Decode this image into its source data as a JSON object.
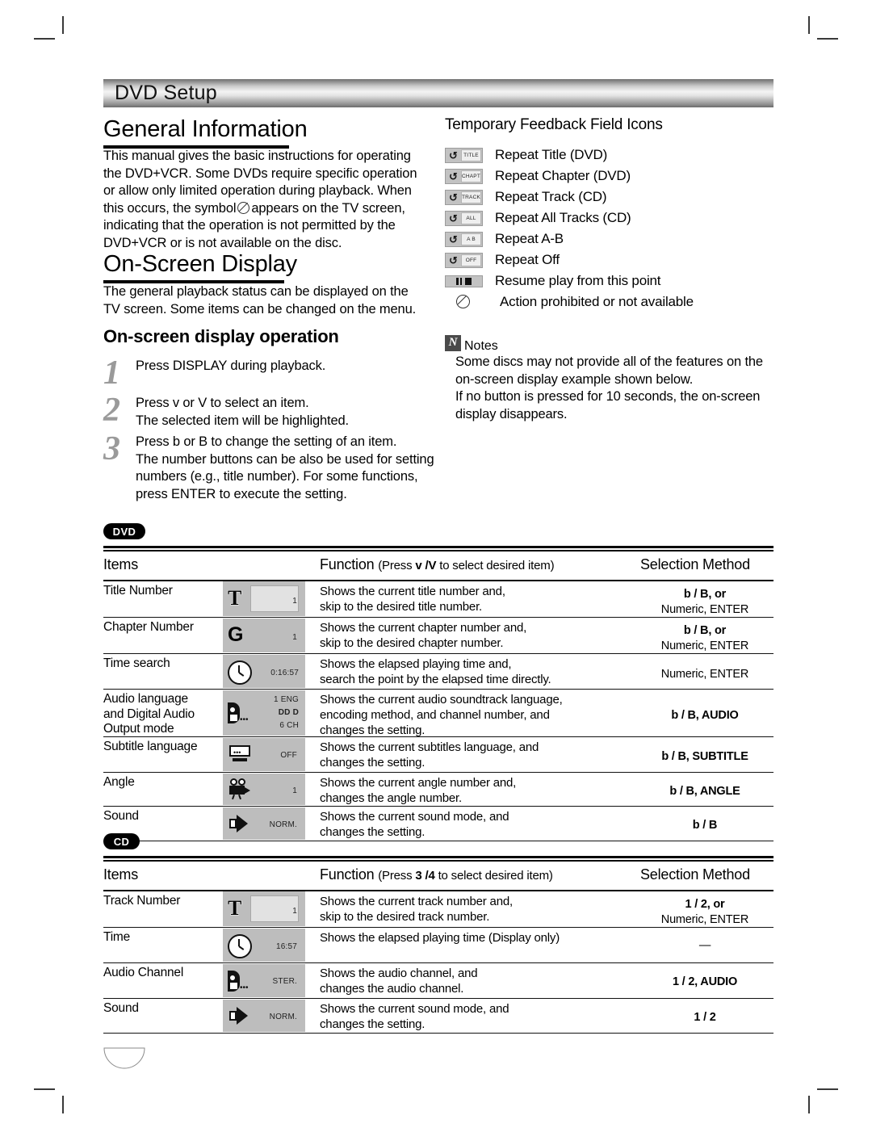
{
  "chapter": {
    "title": "DVD Setup"
  },
  "sections": {
    "general": {
      "heading": "General Information",
      "body_lines": [
        "This manual gives the basic instructions for operating",
        "the DVD+VCR. Some DVDs require specific operation",
        "or allow only limited operation during playback. When",
        "this occurs, the symbol",
        "appears on the TV screen,",
        "indicating that the operation is not permitted by the",
        "DVD+VCR or is not available on the disc."
      ]
    },
    "osd": {
      "heading": "On-Screen Display",
      "body_lines": [
        "The general playback status can be displayed on the",
        "TV screen. Some items can be changed on the menu."
      ],
      "sub_heading": "On-screen display operation",
      "steps": [
        {
          "num": "1",
          "lines": [
            "Press DISPLAY during playback."
          ]
        },
        {
          "num": "2",
          "lines": [
            "Press v  or V to select an item.",
            "The selected item will be highlighted."
          ]
        },
        {
          "num": "3",
          "lines": [
            "Press b  or B to change the setting of an item.",
            "The number buttons can be also be used for setting",
            "numbers (e.g., title number). For some functions,",
            "press ENTER to execute the setting."
          ]
        }
      ]
    }
  },
  "feedback_icons": {
    "title": "Temporary Feedback Field Icons",
    "items": [
      {
        "tag": "TITLE",
        "glyph": "repeat-icon",
        "label": "Repeat Title (DVD)"
      },
      {
        "tag": "CHAPT",
        "glyph": "repeat-icon",
        "label": "Repeat Chapter (DVD)"
      },
      {
        "tag": "TRACK",
        "glyph": "repeat-icon",
        "label": "Repeat Track (CD)"
      },
      {
        "tag": "ALL",
        "glyph": "repeat-icon",
        "label": "Repeat All Tracks (CD)"
      },
      {
        "tag": "A  B",
        "glyph": "repeat-ab-icon",
        "label": "Repeat A-B"
      },
      {
        "tag": "OFF",
        "glyph": "repeat-icon",
        "label": "Repeat Off"
      },
      {
        "tag": "",
        "glyph": "pause-stop-icon",
        "label": "Resume play from this point"
      },
      {
        "tag": "",
        "glyph": "prohibited-icon",
        "label": "Action prohibited or not available"
      }
    ]
  },
  "notes": {
    "icon_letter": "N",
    "label": "Notes",
    "lines": [
      "Some discs may not provide all of the features on the",
      "on-screen display example shown below.",
      "If no button is pressed for 10 seconds, the on-screen",
      "display disappears."
    ]
  },
  "dvd_table": {
    "badge": "DVD",
    "columns": {
      "items": "Items",
      "function": "Function",
      "function_hint_pre": "(Press ",
      "function_hint_keys": "v /V",
      "function_hint_post": " to select desired item)",
      "selection": "Selection Method"
    },
    "rows": [
      {
        "item_lines": [
          "Title Number"
        ],
        "osd": {
          "glyph": "title-T-icon",
          "value": "1"
        },
        "func_lines": [
          "Shows the current title number and,",
          "skip to the desired title number."
        ],
        "sel_lines": [
          "b / B, or",
          "Numeric, ENTER"
        ]
      },
      {
        "item_lines": [
          "Chapter Number"
        ],
        "osd": {
          "glyph": "chapter-C-icon",
          "value": "1"
        },
        "func_lines": [
          "Shows the current chapter number and,",
          "skip to the desired chapter number."
        ],
        "sel_lines": [
          "b / B, or",
          "Numeric, ENTER"
        ]
      },
      {
        "item_lines": [
          "Time search"
        ],
        "osd": {
          "glyph": "clock-icon",
          "value": "0:16:57"
        },
        "func_lines": [
          "Shows the elapsed playing time and,",
          "search the point by the elapsed time directly."
        ],
        "sel_lines": [
          "Numeric, ENTER"
        ]
      },
      {
        "item_lines": [
          "Audio language",
          "and Digital Audio",
          "Output mode"
        ],
        "osd": {
          "glyph": "audio-icon",
          "value": "1  ENG",
          "value2": "DD D",
          "value3": "6  CH"
        },
        "func_lines": [
          "Shows the current audio soundtrack language,",
          "encoding method, and channel number, and",
          "changes the setting."
        ],
        "sel_lines": [
          "b / B, AUDIO"
        ]
      },
      {
        "item_lines": [
          "Subtitle language"
        ],
        "osd": {
          "glyph": "subtitle-icon",
          "value": "OFF"
        },
        "func_lines": [
          "Shows the current subtitles language, and",
          "changes the setting."
        ],
        "sel_lines": [
          "b / B, SUBTITLE"
        ]
      },
      {
        "item_lines": [
          "Angle"
        ],
        "osd": {
          "glyph": "angle-camera-icon",
          "value": "1"
        },
        "func_lines": [
          "Shows the current angle number and,",
          "changes the angle number."
        ],
        "sel_lines": [
          "b / B, ANGLE"
        ]
      },
      {
        "item_lines": [
          "Sound"
        ],
        "osd": {
          "glyph": "speaker-icon",
          "value": "NORM."
        },
        "func_lines": [
          "Shows the current sound mode, and",
          "changes the setting."
        ],
        "sel_lines": [
          "b / B"
        ]
      }
    ]
  },
  "cd_table": {
    "badge": "CD",
    "columns": {
      "items": "Items",
      "function": "Function",
      "function_hint_pre": "(Press ",
      "function_hint_keys": "3 /4",
      "function_hint_post": " to select desired item)",
      "selection": "Selection Method"
    },
    "rows": [
      {
        "item_lines": [
          "Track Number"
        ],
        "osd": {
          "glyph": "title-T-icon",
          "value": "1"
        },
        "func_lines": [
          "Shows the current track number and,",
          "skip to the desired track number."
        ],
        "sel_lines": [
          "1 / 2, or",
          "Numeric, ENTER"
        ]
      },
      {
        "item_lines": [
          "Time"
        ],
        "osd": {
          "glyph": "clock-icon",
          "value": "16:57"
        },
        "func_lines": [
          "Shows the elapsed playing time (Display only)"
        ],
        "sel_lines": [
          "—"
        ]
      },
      {
        "item_lines": [
          "Audio Channel"
        ],
        "osd": {
          "glyph": "audio-icon",
          "value": "STER."
        },
        "func_lines": [
          "Shows the audio channel, and",
          "changes the audio channel."
        ],
        "sel_lines": [
          "1 / 2, AUDIO"
        ]
      },
      {
        "item_lines": [
          "Sound"
        ],
        "osd": {
          "glyph": "speaker-icon",
          "value": "NORM."
        },
        "func_lines": [
          "Shows the current sound mode, and",
          "changes the setting."
        ],
        "sel_lines": [
          "1 / 2"
        ]
      }
    ]
  },
  "colors": {
    "osd_cell_bg": "#bdbdbd",
    "badge_bg": "#000000",
    "step_number": "#9a9a9a",
    "notes_icon_bg": "#4a4a4a"
  }
}
